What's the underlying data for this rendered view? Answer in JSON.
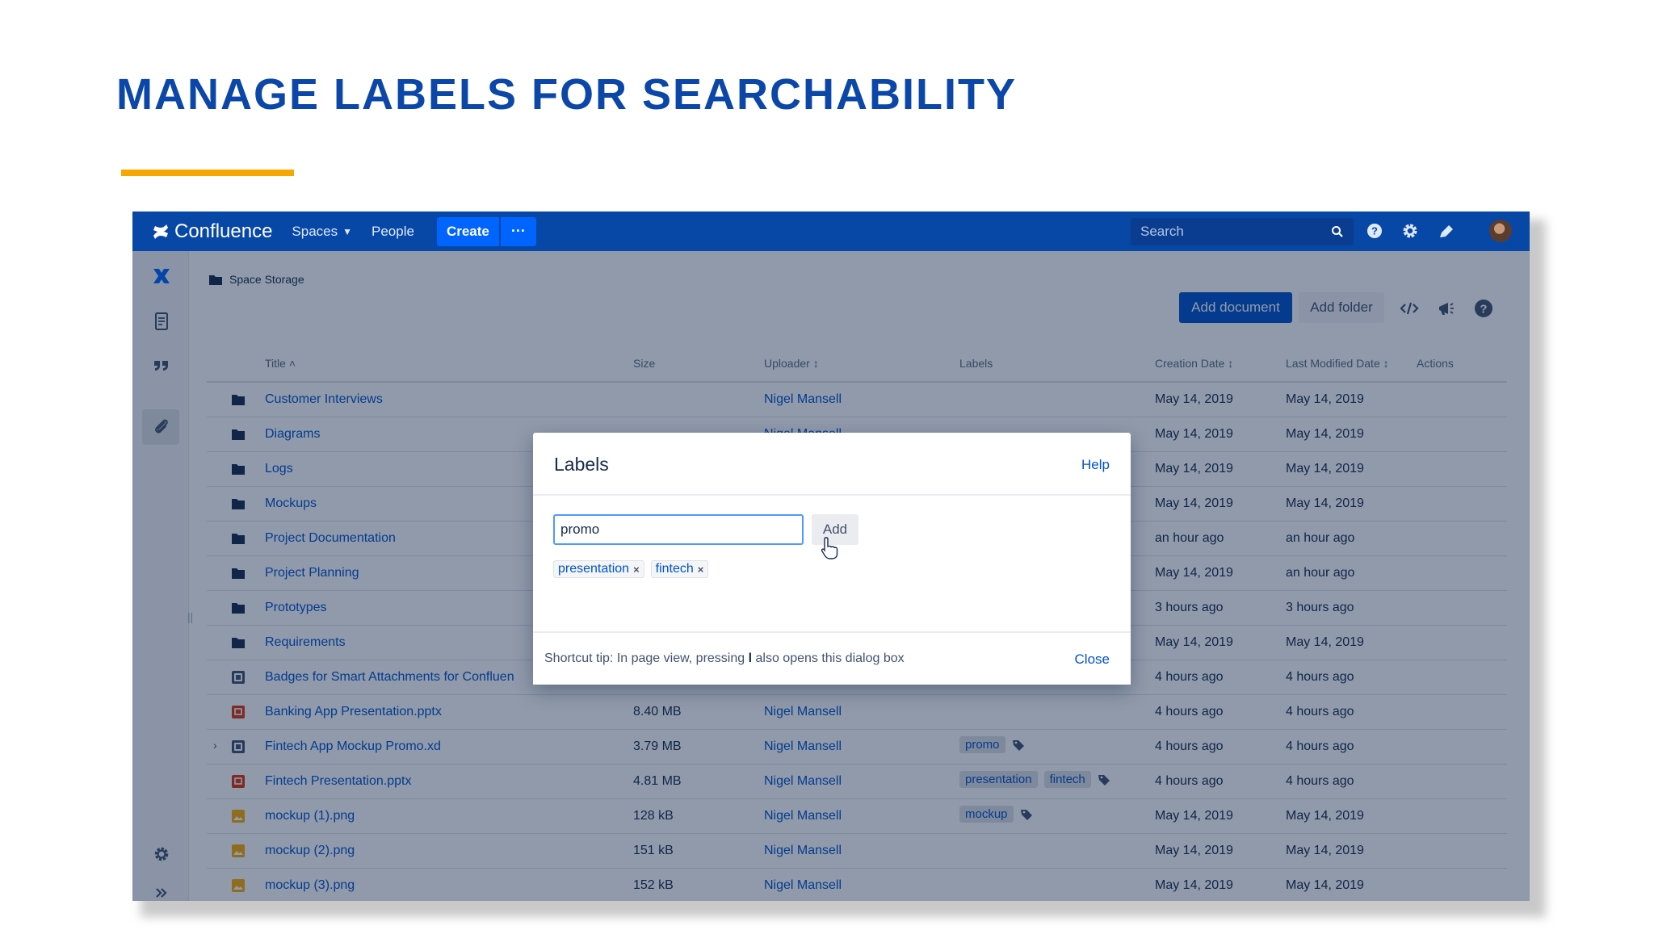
{
  "slide": {
    "title": "MANAGE LABELS FOR SEARCHABILITY"
  },
  "colors": {
    "accent_rule": "#f6a800",
    "title_blue": "#0b47a8",
    "nav_blue": "#0747a6"
  },
  "topnav": {
    "brand": "Confluence",
    "spaces": "Spaces",
    "people": "People",
    "create": "Create",
    "more": "···",
    "search_placeholder": "Search"
  },
  "breadcrumb": {
    "label": "Space Storage"
  },
  "toolbar": {
    "add_document": "Add document",
    "add_folder": "Add folder"
  },
  "table": {
    "headers": {
      "title": "Title ˄",
      "size": "Size",
      "uploader": "Uploader ↕",
      "labels": "Labels",
      "creation": "Creation Date ↕",
      "modified": "Last Modified Date ↕",
      "actions": "Actions"
    },
    "rows": [
      {
        "title": "Customer Interviews",
        "size": "",
        "uploader": "Nigel Mansell",
        "labels": [],
        "created": "May 14, 2019",
        "modified": "May 14, 2019"
      },
      {
        "title": "Diagrams",
        "size": "",
        "uploader": "Nigel Mansell",
        "labels": [],
        "created": "May 14, 2019",
        "modified": "May 14, 2019"
      },
      {
        "title": "Logs",
        "size": "",
        "uploader": "",
        "labels": [],
        "created": "May 14, 2019",
        "modified": "May 14, 2019"
      },
      {
        "title": "Mockups",
        "size": "",
        "uploader": "",
        "labels": [],
        "created": "May 14, 2019",
        "modified": "May 14, 2019"
      },
      {
        "title": "Project Documentation",
        "size": "",
        "uploader": "",
        "labels": [],
        "created": "an hour ago",
        "modified": "an hour ago"
      },
      {
        "title": "Project Planning",
        "size": "",
        "uploader": "",
        "labels": [],
        "created": "May 14, 2019",
        "modified": "an hour ago"
      },
      {
        "title": "Prototypes",
        "size": "",
        "uploader": "",
        "labels": [],
        "created": "3 hours ago",
        "modified": "3 hours ago"
      },
      {
        "title": "Requirements",
        "size": "",
        "uploader": "",
        "labels": [],
        "created": "May 14, 2019",
        "modified": "May 14, 2019"
      },
      {
        "title": "Badges for Smart Attachments for Confluen",
        "size": "",
        "uploader": "",
        "labels": [],
        "created": "4 hours ago",
        "modified": "4 hours ago"
      },
      {
        "title": "Banking App Presentation.pptx",
        "size": "8.40 MB",
        "uploader": "Nigel Mansell",
        "labels": [],
        "created": "4 hours ago",
        "modified": "4 hours ago"
      },
      {
        "title": "Fintech App Mockup Promo.xd",
        "size": "3.79 MB",
        "uploader": "Nigel Mansell",
        "labels": [
          "promo"
        ],
        "created": "4 hours ago",
        "modified": "4 hours ago"
      },
      {
        "title": "Fintech Presentation.pptx",
        "size": "4.81 MB",
        "uploader": "Nigel Mansell",
        "labels": [
          "presentation",
          "fintech"
        ],
        "created": "4 hours ago",
        "modified": "4 hours ago"
      },
      {
        "title": "mockup (1).png",
        "size": "128 kB",
        "uploader": "Nigel Mansell",
        "labels": [
          "mockup"
        ],
        "created": "May 14, 2019",
        "modified": "May 14, 2019"
      },
      {
        "title": "mockup (2).png",
        "size": "151 kB",
        "uploader": "Nigel Mansell",
        "labels": [],
        "created": "May 14, 2019",
        "modified": "May 14, 2019"
      },
      {
        "title": "mockup (3).png",
        "size": "152 kB",
        "uploader": "Nigel Mansell",
        "labels": [],
        "created": "May 14, 2019",
        "modified": "May 14, 2019"
      }
    ]
  },
  "dialog": {
    "title": "Labels",
    "help": "Help",
    "input_value": "promo",
    "add": "Add",
    "chips": [
      "presentation",
      "fintech"
    ],
    "chip_remove": "×",
    "tip_before": "Shortcut tip: In page view, pressing ",
    "tip_key": "l",
    "tip_after": " also opens this dialog box",
    "close": "Close"
  }
}
